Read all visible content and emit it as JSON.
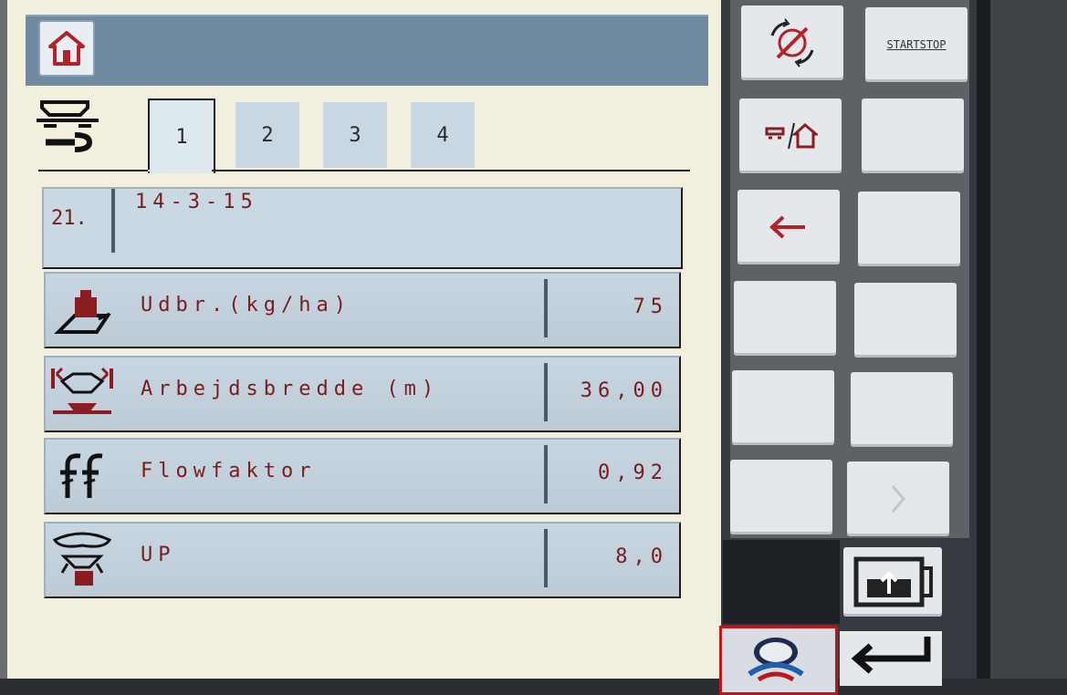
{
  "tabs": [
    {
      "label": "1",
      "active": true
    },
    {
      "label": "2",
      "active": false
    },
    {
      "label": "3",
      "active": false
    },
    {
      "label": "4",
      "active": false
    }
  ],
  "product": {
    "number": "21.",
    "name": "14-3-15"
  },
  "params": [
    {
      "label": "Udbr.(kg/ha)",
      "value": "75",
      "icon": "weight-rate-icon"
    },
    {
      "label": "Arbejdsbredde (m)",
      "value": "36,00",
      "icon": "working-width-icon"
    },
    {
      "label": "Flowfaktor",
      "value": "0,92",
      "icon": "flow-factor-icon"
    },
    {
      "label": "UP",
      "value": "8,0",
      "icon": "spread-disc-icon"
    }
  ],
  "softkeys": {
    "start_stop_line1": "START",
    "start_stop_line2": "STOP"
  },
  "colors": {
    "text_red": "#7a1c1c",
    "row_blue": "#c7d6e1",
    "header_blue": "#6f8aa1",
    "isobus_red": "#c0151a"
  }
}
